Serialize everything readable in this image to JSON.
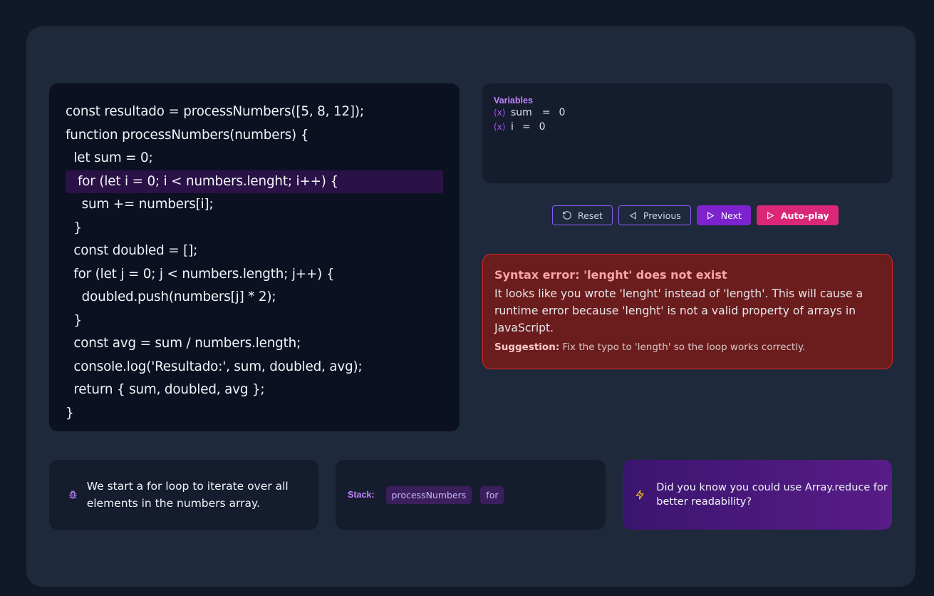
{
  "code": {
    "lines": [
      "const resultado = processNumbers([5, 8, 12]);",
      "function processNumbers(numbers) {",
      "  let sum = 0;",
      "   for (let i = 0; i < numbers.lenght; i++) {",
      "    sum += numbers[i];",
      "  }",
      "  const doubled = [];",
      "  for (let j = 0; j < numbers.length; j++) {",
      "    doubled.push(numbers[j] * 2);",
      "  }",
      "  const avg = sum / numbers.length;",
      "  console.log('Resultado:', sum, doubled, avg);",
      "  return { sum, doubled, avg };",
      "}"
    ],
    "active_line": 3
  },
  "variables": {
    "title": "Variables",
    "items": [
      {
        "name": "sum",
        "eq": "=",
        "value": "0"
      },
      {
        "name": "i",
        "eq": "=",
        "value": "0"
      }
    ]
  },
  "controls": {
    "reset": "Reset",
    "previous": "Previous",
    "next": "Next",
    "autoplay": "Auto-play"
  },
  "error": {
    "title": "Syntax error: 'lenght' does not exist",
    "body": "It looks like you wrote 'lenght' instead of 'length'. This will cause a runtime error because 'lenght' is not a valid property of arrays in JavaScript.",
    "suggestion_label": "Suggestion:",
    "suggestion": "Fix the typo to 'length' so the loop works correctly."
  },
  "explanation": {
    "text": "We start a for loop to iterate over all elements in the numbers array."
  },
  "stack": {
    "label": "Stack:",
    "frames": [
      "processNumbers",
      "for"
    ]
  },
  "tip": {
    "text": "Did you know you could use Array.reduce for better readability?"
  },
  "colors": {
    "accent": "#a855f7",
    "error_bg": "#6b1c1c",
    "error_border": "#dc2626",
    "autoplay": "#db2777",
    "tip_icon": "#facc15"
  },
  "icons": {
    "variable": "variable-icon",
    "reset": "rotate-ccw-icon",
    "previous": "triangle-left-icon",
    "next": "play-icon",
    "autoplay": "play-icon",
    "explanation": "bug-icon",
    "tip": "lightning-icon"
  }
}
